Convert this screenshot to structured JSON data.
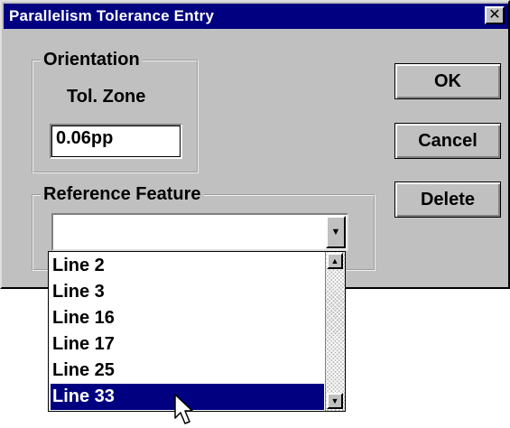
{
  "window": {
    "title": "Parallelism Tolerance Entry",
    "close_glyph": "✕"
  },
  "orientation": {
    "group_label": "Orientation",
    "tol_zone_label": "Tol. Zone",
    "tol_zone_value": "0.06pp"
  },
  "reference": {
    "group_label": "Reference Feature",
    "selected_value": "",
    "arrow_glyph": "▼",
    "options": [
      "Line 2",
      "Line 3",
      "Line 16",
      "Line 17",
      "Line 25",
      "Line 33"
    ],
    "highlighted": "Line 33"
  },
  "buttons": {
    "ok": "OK",
    "cancel": "Cancel",
    "delete": "Delete"
  },
  "scrollbar": {
    "up_glyph": "▲",
    "down_glyph": "▼"
  },
  "colors": {
    "titlebar": "#000080",
    "face": "#c0c0c0",
    "selection": "#000080"
  }
}
